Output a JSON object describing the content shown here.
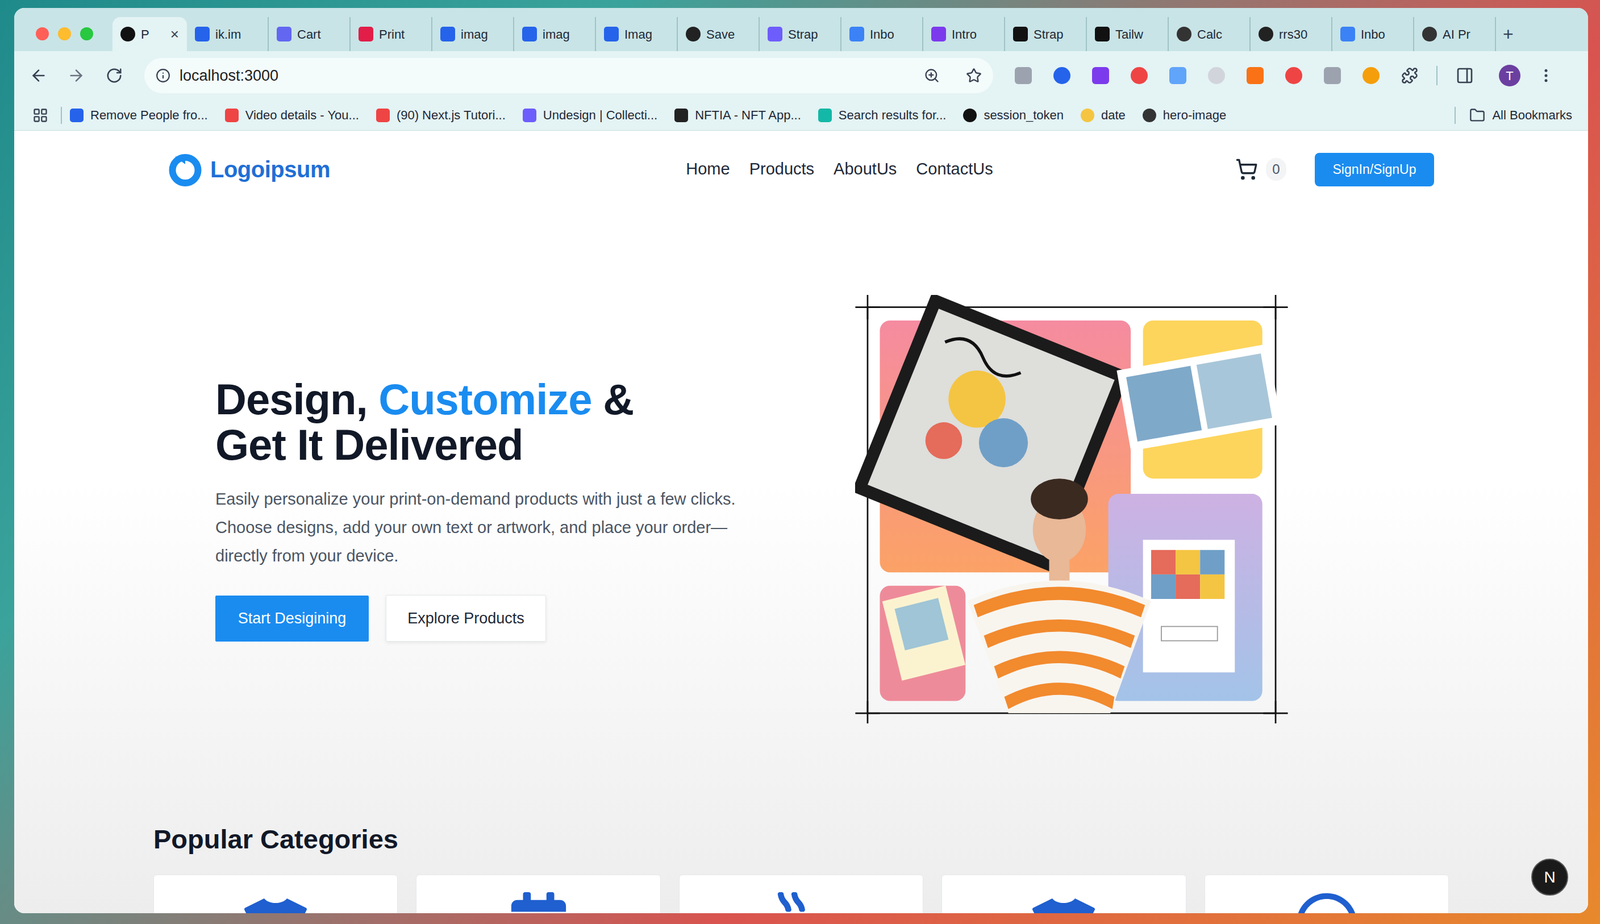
{
  "browser": {
    "tabs": [
      {
        "label": "P",
        "selected": true,
        "close": "×"
      },
      {
        "label": "ik.im",
        "selected": false
      },
      {
        "label": "Cart",
        "selected": false
      },
      {
        "label": "Print",
        "selected": false
      },
      {
        "label": "imag",
        "selected": false
      },
      {
        "label": "imag",
        "selected": false
      },
      {
        "label": "Imag",
        "selected": false
      },
      {
        "label": "Save",
        "selected": false
      },
      {
        "label": "Strap",
        "selected": false
      },
      {
        "label": "Inbo",
        "selected": false
      },
      {
        "label": "Intro",
        "selected": false
      },
      {
        "label": "Strap",
        "selected": false
      },
      {
        "label": "Tailw",
        "selected": false
      },
      {
        "label": "Calc",
        "selected": false
      },
      {
        "label": "rrs30",
        "selected": false
      },
      {
        "label": "Inbo",
        "selected": false
      },
      {
        "label": "AI Pr",
        "selected": false
      }
    ],
    "new_tab": "+",
    "address": "localhost:3000",
    "profile": "T",
    "bookmarks": [
      "Remove People fro...",
      "Video details - You...",
      "(90) Next.js Tutori...",
      "Undesign | Collecti...",
      "NFTIA - NFT App...",
      "Search results for...",
      "session_token",
      "date",
      "hero-image"
    ],
    "all_bookmarks": "All Bookmarks"
  },
  "page": {
    "logo": "Logoipsum",
    "nav": [
      "Home",
      "Products",
      "AboutUs",
      "ContactUs"
    ],
    "cart_count": "0",
    "auth_button": "SignIn/SignUp",
    "hero": {
      "title_line1": [
        {
          "text": "Design,",
          "highlight": false
        },
        {
          "text": "Customize",
          "highlight": true
        },
        {
          "text": "&",
          "highlight": false
        }
      ],
      "title_line2": "Get It Delivered",
      "description": "Easily personalize your print-on-demand products with just a few clicks. Choose designs, add your own text or artwork, and place your order—directly from your device.",
      "primary_button": "Start Desigining",
      "secondary_button": "Explore Products"
    },
    "section_title": "Popular Categories",
    "dev_indicator": "N"
  }
}
